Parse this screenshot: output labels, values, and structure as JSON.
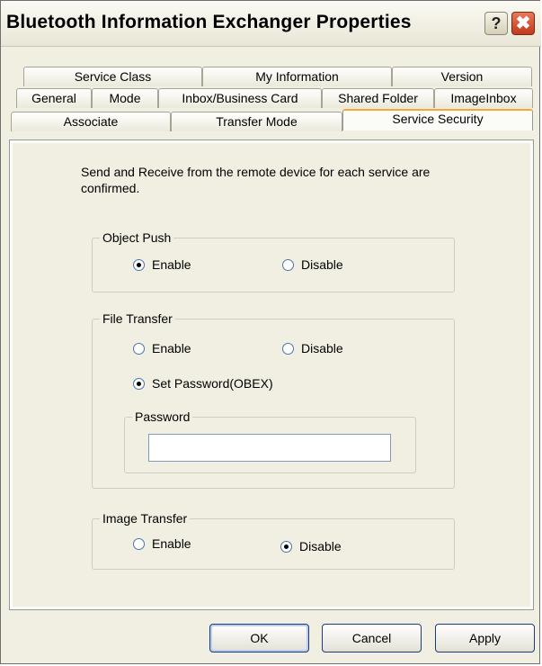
{
  "window": {
    "title": "Bluetooth Information Exchanger Properties",
    "help_label": "?",
    "close_label": "✖"
  },
  "tabs": {
    "row1": [
      "Service Class",
      "My Information",
      "Version"
    ],
    "row2": [
      "General",
      "Mode",
      "Inbox/Business Card",
      "Shared Folder",
      "ImageInbox"
    ],
    "row3": [
      "Associate",
      "Transfer Mode",
      "Service Security"
    ],
    "selected": "Service Security"
  },
  "description": "Send and Receive from the remote device for each service are confirmed.",
  "object_push": {
    "legend": "Object Push",
    "enable_label": "Enable",
    "disable_label": "Disable",
    "selected": "Enable"
  },
  "file_transfer": {
    "legend": "File Transfer",
    "enable_label": "Enable",
    "disable_label": "Disable",
    "set_password_label": "Set Password(OBEX)",
    "selected": "Set Password(OBEX)",
    "password_legend": "Password",
    "password_value": ""
  },
  "image_transfer": {
    "legend": "Image Transfer",
    "enable_label": "Enable",
    "disable_label": "Disable",
    "selected": "Disable"
  },
  "buttons": {
    "ok": "OK",
    "cancel": "Cancel",
    "apply": "Apply"
  }
}
